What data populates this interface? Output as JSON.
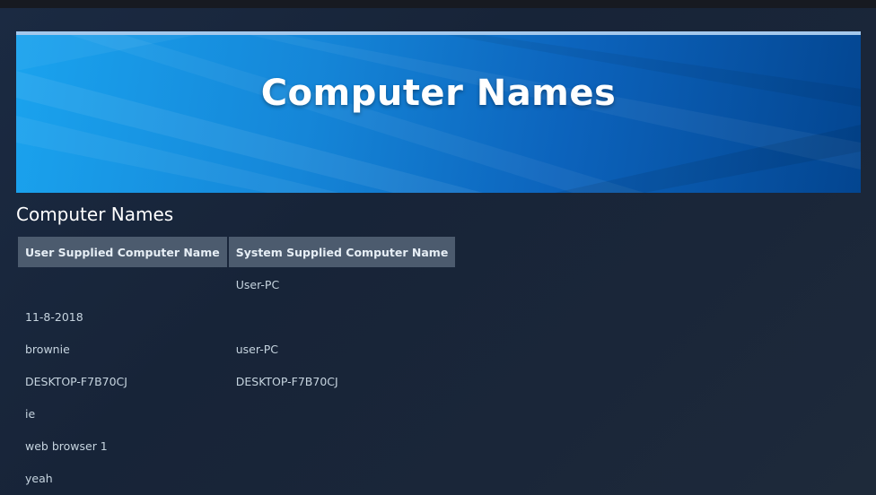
{
  "banner": {
    "title": "Computer Names"
  },
  "section": {
    "title": "Computer Names"
  },
  "table": {
    "columns": [
      "User Supplied Computer Name",
      "System Supplied Computer Name"
    ],
    "rows": [
      [
        "",
        "User-PC"
      ],
      [
        "11-8-2018",
        ""
      ],
      [
        "brownie",
        "user-PC"
      ],
      [
        "DESKTOP-F7B70CJ",
        "DESKTOP-F7B70CJ"
      ],
      [
        "ie",
        ""
      ],
      [
        "web browser 1",
        ""
      ],
      [
        "yeah",
        ""
      ]
    ]
  },
  "colors": {
    "page_background": "#1b2a42",
    "banner_start": "#1aa3ee",
    "banner_end": "#034590",
    "banner_top_border": "#a4c8ec",
    "header_cell": "#4c5b6e",
    "text": "#c6d4df"
  }
}
